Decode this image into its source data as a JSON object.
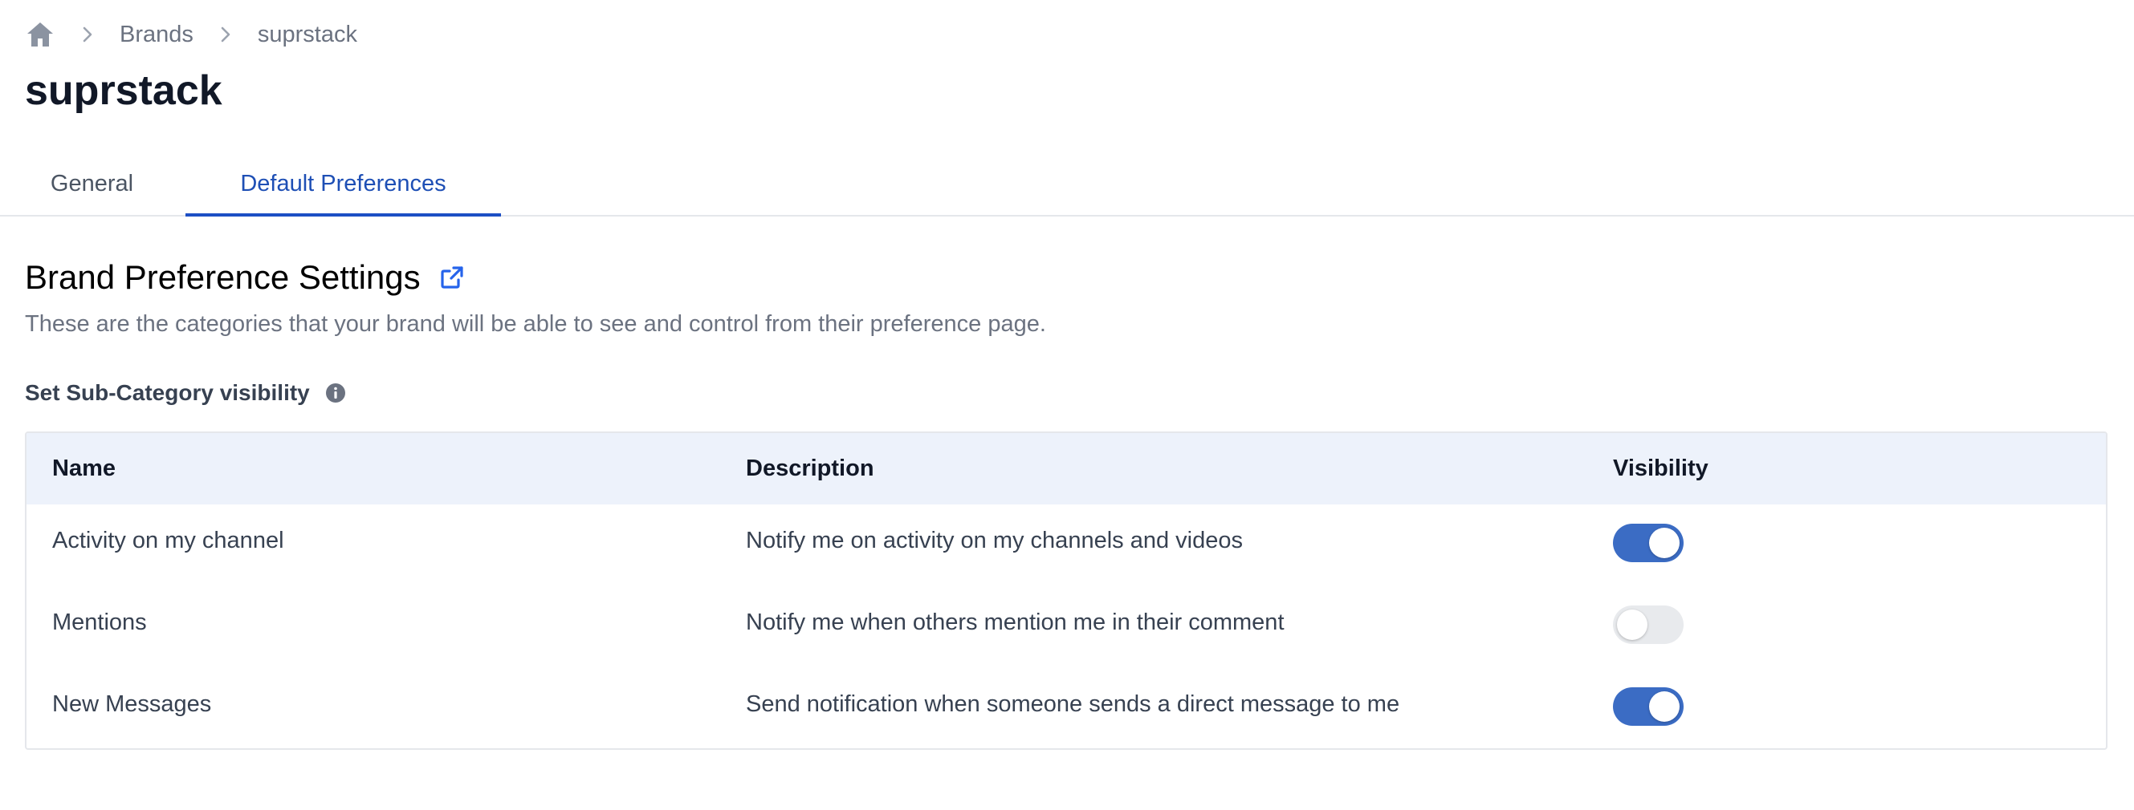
{
  "breadcrumb": {
    "home_icon": "home-icon",
    "separator_icon": "chevron-right-icon",
    "items": [
      {
        "label": "Brands"
      },
      {
        "label": "suprstack"
      }
    ]
  },
  "page": {
    "title": "suprstack"
  },
  "tabs": [
    {
      "label": "General",
      "active": false
    },
    {
      "label": "Default Preferences",
      "active": true
    }
  ],
  "section": {
    "heading": "Brand Preference Settings",
    "heading_icon": "external-link-icon",
    "description": "These are the categories that your brand will be able to see and control from their preference page."
  },
  "subcategory": {
    "label": "Set Sub-Category visibility",
    "info_icon": "info-icon"
  },
  "table": {
    "headers": {
      "name": "Name",
      "description": "Description",
      "visibility": "Visibility"
    },
    "rows": [
      {
        "name": "Activity on my channel",
        "description": "Notify me on activity on my channels and videos",
        "visible": true
      },
      {
        "name": "Mentions",
        "description": "Notify me when others mention me in their comment",
        "visible": false
      },
      {
        "name": "New Messages",
        "description": "Send notification when someone sends a direct message to me",
        "visible": true
      }
    ]
  },
  "colors": {
    "accent": "#1d4fc4",
    "toggle_on": "#3b6cc4",
    "toggle_off": "#e8eaed",
    "table_header_bg": "#edf2fb"
  }
}
